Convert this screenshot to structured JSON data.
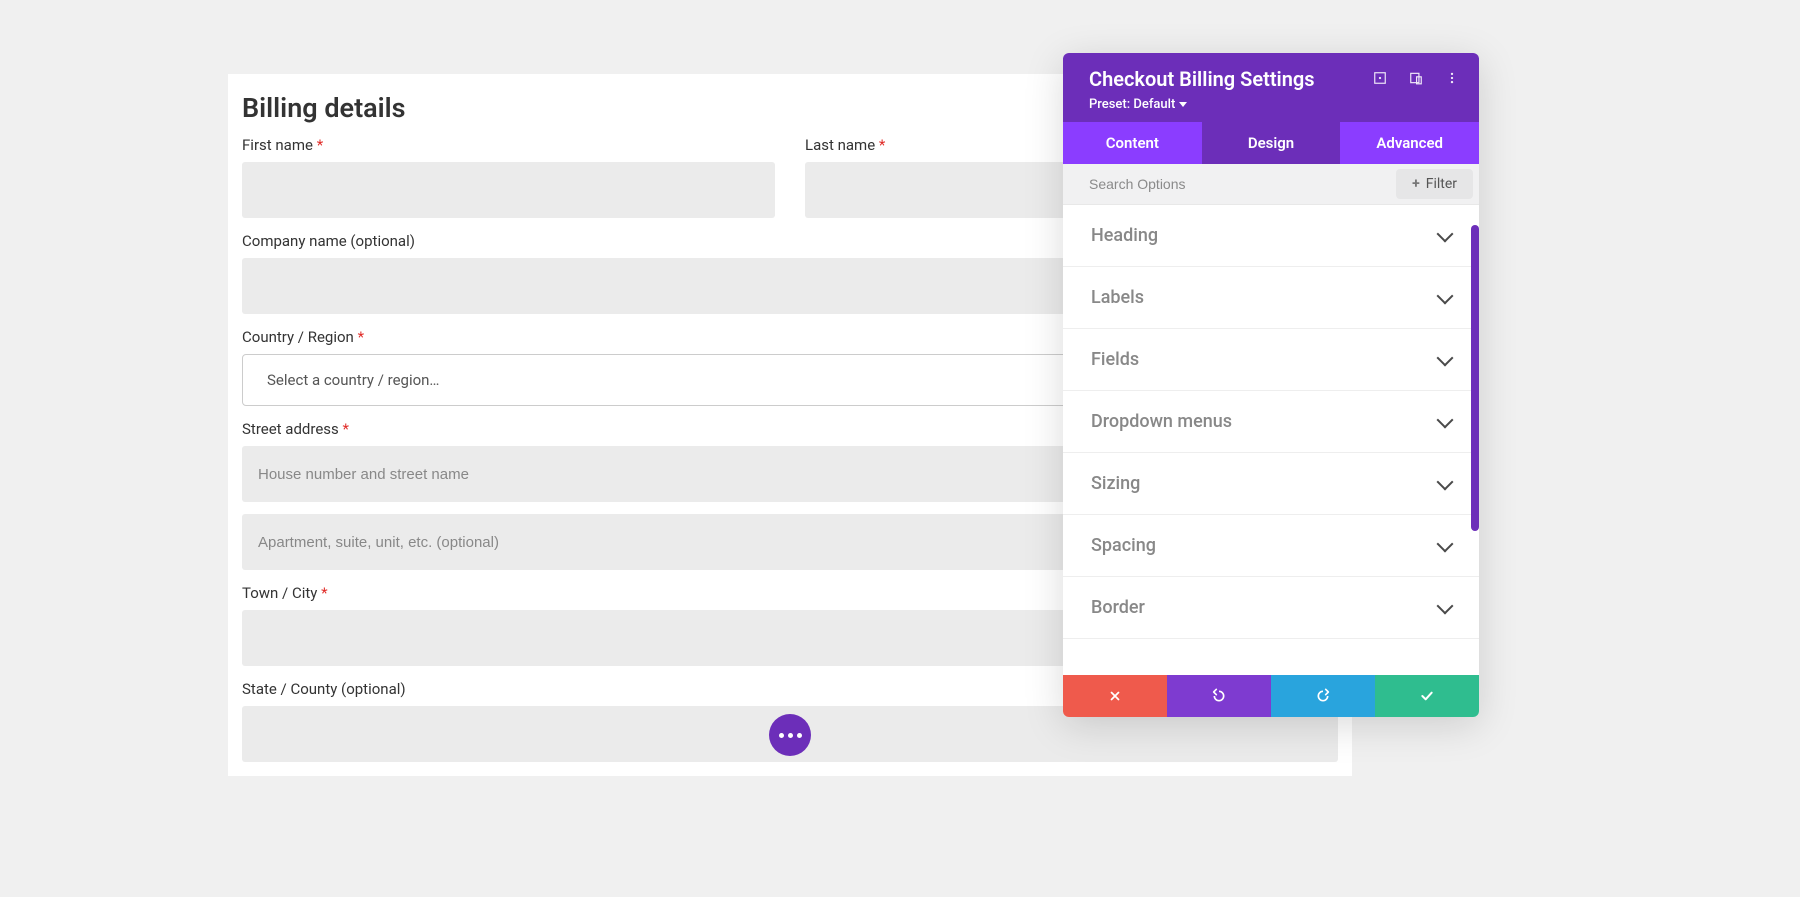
{
  "billing": {
    "heading": "Billing details",
    "fields": {
      "first_name": {
        "label": "First name",
        "required": true,
        "value": ""
      },
      "last_name": {
        "label": "Last name",
        "required": true,
        "value": ""
      },
      "company": {
        "label": "Company name (optional)",
        "required": false,
        "value": ""
      },
      "country": {
        "label": "Country / Region",
        "required": true,
        "placeholder": "Select a country / region…"
      },
      "street": {
        "label": "Street address",
        "required": true,
        "placeholder1": "House number and street name",
        "placeholder2": "Apartment, suite, unit, etc. (optional)"
      },
      "city": {
        "label": "Town / City",
        "required": true,
        "value": ""
      },
      "state": {
        "label": "State / County (optional)",
        "required": false,
        "value": ""
      }
    }
  },
  "panel": {
    "title": "Checkout Billing Settings",
    "preset_label": "Preset: Default",
    "tabs": {
      "content": "Content",
      "design": "Design",
      "advanced": "Advanced",
      "active": "design"
    },
    "search_placeholder": "Search Options",
    "filter_label": "Filter",
    "options": [
      {
        "label": "Heading"
      },
      {
        "label": "Labels"
      },
      {
        "label": "Fields"
      },
      {
        "label": "Dropdown menus"
      },
      {
        "label": "Sizing"
      },
      {
        "label": "Spacing"
      },
      {
        "label": "Border"
      }
    ],
    "footer": {
      "close": "close",
      "undo": "undo",
      "redo": "redo",
      "save": "save"
    },
    "header_icons": {
      "expand": "expand-icon",
      "responsive": "responsive-icon",
      "menu": "menu-icon"
    }
  },
  "required_star": "*",
  "colors": {
    "purple_dark": "#6c2eb9",
    "purple_light": "#8b3dff",
    "red": "#ef5a4c",
    "blue": "#29a4dd",
    "green": "#2fbd8f"
  }
}
